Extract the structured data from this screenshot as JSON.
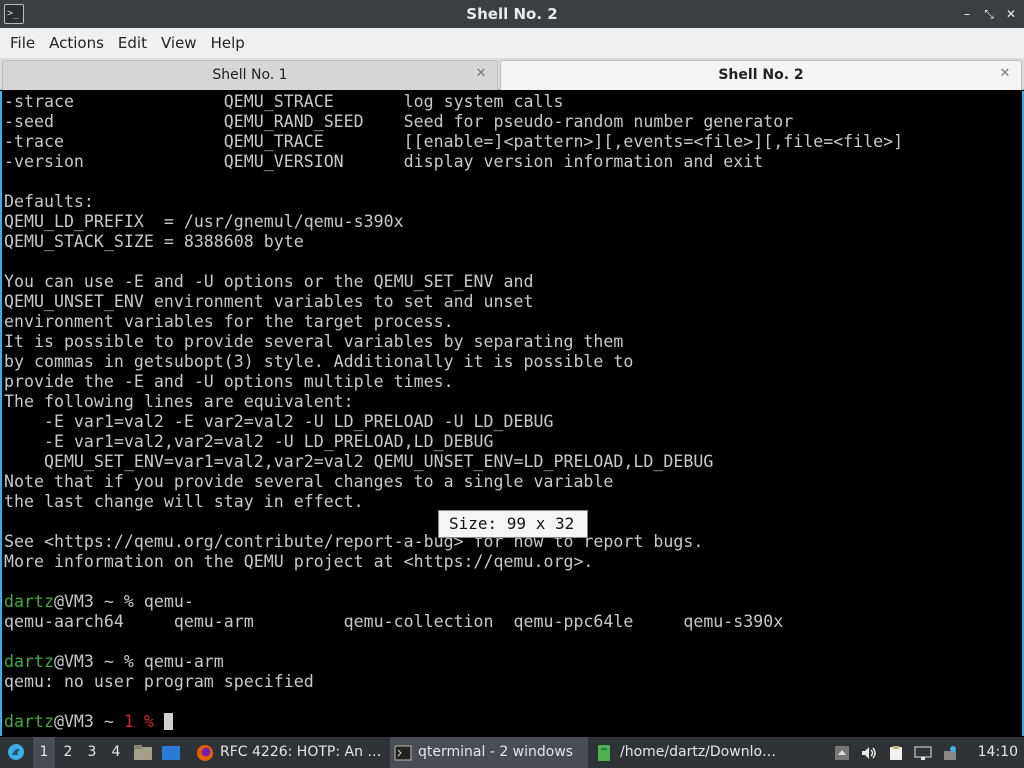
{
  "window": {
    "title": "Shell No. 2",
    "app_icon": ">_",
    "controls": [
      "–",
      "⤡",
      "✕"
    ]
  },
  "menu": [
    "File",
    "Actions",
    "Edit",
    "View",
    "Help"
  ],
  "tabs": [
    {
      "label": "Shell No. 1",
      "active": false
    },
    {
      "label": "Shell No. 2",
      "active": true
    }
  ],
  "terminal": {
    "lines": [
      "-strace               QEMU_STRACE       log system calls",
      "-seed                 QEMU_RAND_SEED    Seed for pseudo-random number generator",
      "-trace                QEMU_TRACE        [[enable=]<pattern>][,events=<file>][,file=<file>]",
      "-version              QEMU_VERSION      display version information and exit",
      "",
      "Defaults:",
      "QEMU_LD_PREFIX  = /usr/gnemul/qemu-s390x",
      "QEMU_STACK_SIZE = 8388608 byte",
      "",
      "You can use -E and -U options or the QEMU_SET_ENV and",
      "QEMU_UNSET_ENV environment variables to set and unset",
      "environment variables for the target process.",
      "It is possible to provide several variables by separating them",
      "by commas in getsubopt(3) style. Additionally it is possible to",
      "provide the -E and -U options multiple times.",
      "The following lines are equivalent:",
      "    -E var1=val2 -E var2=val2 -U LD_PRELOAD -U LD_DEBUG",
      "    -E var1=val2,var2=val2 -U LD_PRELOAD,LD_DEBUG",
      "    QEMU_SET_ENV=var1=val2,var2=val2 QEMU_UNSET_ENV=LD_PRELOAD,LD_DEBUG",
      "Note that if you provide several changes to a single variable",
      "the last change will stay in effect.",
      "",
      "See <https://qemu.org/contribute/report-a-bug> for how to report bugs.",
      "More information on the QEMU project at <https://qemu.org>.",
      ""
    ],
    "session": [
      {
        "user": "dartz",
        "rest": "@VM3 ~ % qemu-"
      },
      {
        "text": "qemu-aarch64     qemu-arm         qemu-collection  qemu-ppc64le     qemu-s390x"
      },
      {
        "text": ""
      },
      {
        "user": "dartz",
        "rest": "@VM3 ~ % qemu-arm"
      },
      {
        "text": "qemu: no user program specified"
      },
      {
        "text": ""
      },
      {
        "user": "dartz",
        "rest": "@VM3 ~ ",
        "status": "1 %",
        "trail": " "
      }
    ],
    "size_tooltip": "Size: 99 x 32"
  },
  "taskbar": {
    "workspaces": [
      "1",
      "2",
      "3",
      "4"
    ],
    "tasks": [
      {
        "label": "RFC 4226: HOTP: An …",
        "icon": "firefox-icon"
      },
      {
        "label": "qterminal - 2 windows",
        "icon": "terminal-icon"
      },
      {
        "label": "/home/dartz/Downlo…",
        "icon": "folder-icon"
      }
    ],
    "clock": "14:10"
  },
  "colors": {
    "accent": "#3daee9",
    "prompt_user": "#3daa3d",
    "prompt_status": "#cc2222",
    "terminal_text": "#c8c8c8",
    "terminal_bg": "#000000"
  }
}
